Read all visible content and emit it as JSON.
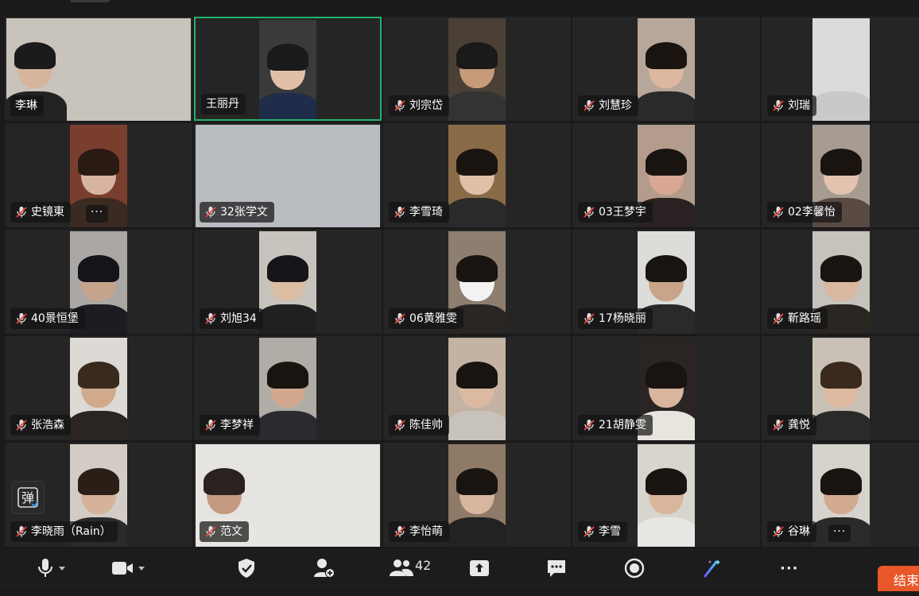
{
  "participants": [
    {
      "name": "李琳",
      "muted": false,
      "speaking": false
    },
    {
      "name": "王丽丹",
      "muted": false,
      "speaking": true
    },
    {
      "name": "刘宗岱",
      "muted": true,
      "speaking": false
    },
    {
      "name": "刘慧珍",
      "muted": true,
      "speaking": false
    },
    {
      "name": "刘瑞",
      "muted": true,
      "speaking": false
    },
    {
      "name": "史镜東",
      "muted": true,
      "speaking": false,
      "more": "···"
    },
    {
      "name": "32张学文",
      "muted": true,
      "speaking": false
    },
    {
      "name": "李雪琦",
      "muted": true,
      "speaking": false
    },
    {
      "name": "03王梦宇",
      "muted": true,
      "speaking": false
    },
    {
      "name": "02李馨怡",
      "muted": true,
      "speaking": false
    },
    {
      "name": "40景恒堡",
      "muted": true,
      "speaking": false
    },
    {
      "name": "刘旭34",
      "muted": true,
      "speaking": false
    },
    {
      "name": "06黄雅雯",
      "muted": true,
      "speaking": false
    },
    {
      "name": "17杨晓丽",
      "muted": true,
      "speaking": false
    },
    {
      "name": "靳路瑶",
      "muted": true,
      "speaking": false
    },
    {
      "name": "张浩森",
      "muted": true,
      "speaking": false
    },
    {
      "name": "李梦祥",
      "muted": true,
      "speaking": false
    },
    {
      "name": "陈佳帅",
      "muted": true,
      "speaking": false
    },
    {
      "name": "21胡静雯",
      "muted": true,
      "speaking": false
    },
    {
      "name": "龚悦",
      "muted": true,
      "speaking": false
    },
    {
      "name": "李晓雨（Rain）",
      "muted": true,
      "speaking": false
    },
    {
      "name": "范文",
      "muted": true,
      "speaking": false
    },
    {
      "name": "李怡萌",
      "muted": true,
      "speaking": false
    },
    {
      "name": "李雪",
      "muted": true,
      "speaking": false
    },
    {
      "name": "谷琳",
      "muted": true,
      "speaking": false,
      "more": "···"
    }
  ],
  "floating": {
    "danmu_glyph": "弹"
  },
  "toolbar": {
    "participants_count": "42",
    "more_label": "···",
    "end_label": "结束"
  },
  "colors": {
    "background": "#1a1a1a",
    "tile": "#252525",
    "speaking_border": "#23b26d",
    "end_button": "#e8572a"
  }
}
